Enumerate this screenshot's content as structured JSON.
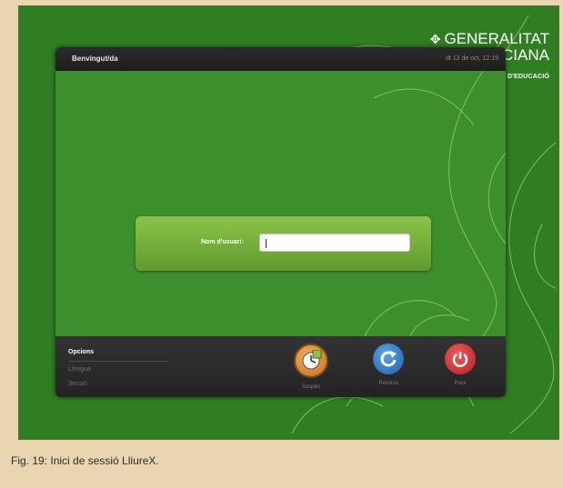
{
  "branding": {
    "line1": "GENERALITAT",
    "line2": "VALENCIANA",
    "subtitle": "CONSELLERIA D'EDUCACIÓ"
  },
  "top_bar": {
    "greeting": "Benvingut/da",
    "clock": "dt 13 de oct, 12:19"
  },
  "login": {
    "username_label": "Nom d'usuari:",
    "username_value": ""
  },
  "options": {
    "title": "Opcions",
    "items": [
      "Llengua",
      "Sessió"
    ]
  },
  "actions": {
    "suspend": "Suspèn",
    "restart": "Reinicia",
    "shutdown": "Para"
  },
  "caption": "Fig. 19: Inici de sessió LliureX.",
  "colors": {
    "background": "#2f7f22",
    "login_box": "#7db83e",
    "restart": "#2f6fb8",
    "shutdown": "#d1292c",
    "suspend": "#e08a2c"
  }
}
